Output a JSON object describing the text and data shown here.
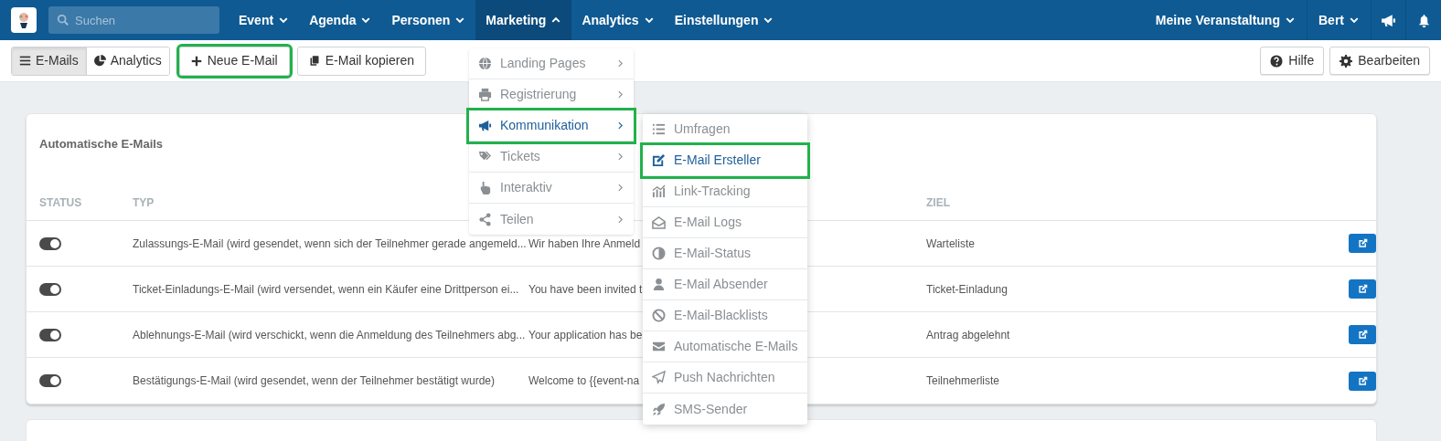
{
  "navbar": {
    "search": {
      "placeholder": "Suchen"
    },
    "menus": [
      {
        "label": "Event",
        "selected": false,
        "expanded": false
      },
      {
        "label": "Agenda",
        "selected": false,
        "expanded": false
      },
      {
        "label": "Personen",
        "selected": false,
        "expanded": false
      },
      {
        "label": "Marketing",
        "selected": true,
        "expanded": true
      },
      {
        "label": "Analytics",
        "selected": false,
        "expanded": false
      },
      {
        "label": "Einstellungen",
        "selected": false,
        "expanded": false
      }
    ],
    "right_menus": [
      {
        "label": "Meine Veranstaltung"
      },
      {
        "label": "Bert"
      }
    ]
  },
  "toolbar": {
    "tabs": [
      {
        "label": "E-Mails",
        "selected": true
      },
      {
        "label": "Analytics",
        "selected": false
      }
    ],
    "buttons": [
      {
        "label": "Neue E-Mail",
        "highlighted": true
      },
      {
        "label": "E-Mail kopieren",
        "highlighted": false
      }
    ],
    "right_buttons": [
      {
        "label": "Hilfe"
      },
      {
        "label": "Bearbeiten"
      }
    ]
  },
  "card": {
    "title": "Automatische E-Mails",
    "columns": {
      "status": "STATUS",
      "type": "TYP",
      "target": "ZIEL"
    },
    "rows": [
      {
        "on": true,
        "type": "Zulassungs-E-Mail (wird gesendet, wenn sich der Teilnehmer gerade angemeld...",
        "subject": "Wir haben Ihre Anmeld",
        "target": "Warteliste"
      },
      {
        "on": true,
        "type": "Ticket-Einladungs-E-Mail (wird versendet, wenn ein Käufer eine Drittperson ei...",
        "subject": "You have been invited t",
        "target": "Ticket-Einladung"
      },
      {
        "on": true,
        "type": "Ablehnungs-E-Mail (wird verschickt, wenn die Anmeldung des Teilnehmers abg...",
        "subject": "Your application has be",
        "target": "Antrag abgelehnt"
      },
      {
        "on": true,
        "type": "Bestätigungs-E-Mail (wird gesendet, wenn der Teilnehmer bestätigt wurde)",
        "subject": "Welcome to {{event-na",
        "target": "Teilnehmerliste"
      }
    ]
  },
  "marketing_menu": {
    "items": [
      {
        "label": "Landing Pages",
        "selected": false,
        "highlighted": false
      },
      {
        "label": "Registrierung",
        "selected": false,
        "highlighted": false
      },
      {
        "label": "Kommunikation",
        "selected": true,
        "highlighted": true
      },
      {
        "label": "Tickets",
        "selected": false,
        "highlighted": false
      },
      {
        "label": "Interaktiv",
        "selected": false,
        "highlighted": false
      },
      {
        "label": "Teilen",
        "selected": false,
        "highlighted": false
      }
    ]
  },
  "submenu": {
    "items": [
      {
        "label": "Umfragen",
        "selected": false,
        "highlighted": false
      },
      {
        "label": "E-Mail Ersteller",
        "selected": true,
        "highlighted": true
      },
      {
        "label": "Link-Tracking",
        "selected": false,
        "highlighted": false
      },
      {
        "label": "E-Mail Logs",
        "selected": false,
        "highlighted": false
      },
      {
        "label": "E-Mail-Status",
        "selected": false,
        "highlighted": false
      },
      {
        "label": "E-Mail Absender",
        "selected": false,
        "highlighted": false
      },
      {
        "label": "E-Mail-Blacklists",
        "selected": false,
        "highlighted": false
      },
      {
        "label": "Automatische E-Mails",
        "selected": false,
        "highlighted": false
      },
      {
        "label": "Push Nachrichten",
        "selected": false,
        "highlighted": false
      },
      {
        "label": "SMS-Sender",
        "selected": false,
        "highlighted": false
      }
    ]
  }
}
